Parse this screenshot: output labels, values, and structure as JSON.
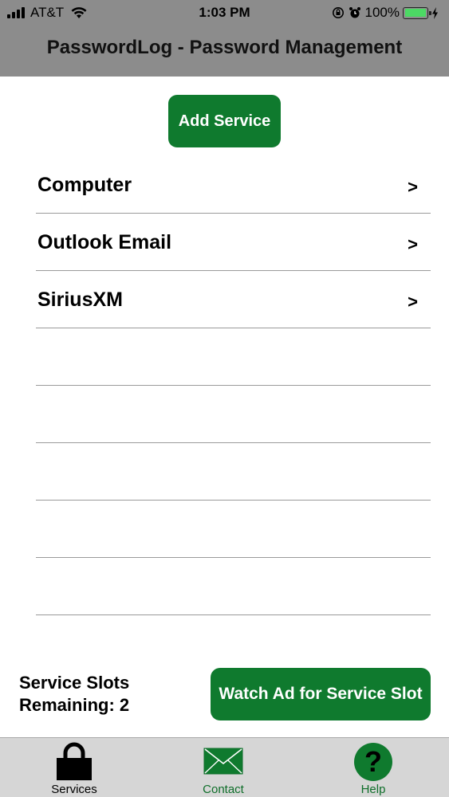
{
  "status_bar": {
    "carrier": "AT&T",
    "time": "1:03 PM",
    "battery_percent": "100%",
    "battery_fraction": 1.0
  },
  "header": {
    "title": "PasswordLog - Password Management"
  },
  "add_service_label": "Add Service",
  "services": [
    {
      "label": "Computer",
      "chevron": ">"
    },
    {
      "label": "Outlook Email",
      "chevron": ">"
    },
    {
      "label": "SiriusXM",
      "chevron": ">"
    },
    {
      "label": "",
      "chevron": ""
    },
    {
      "label": "",
      "chevron": ""
    },
    {
      "label": "",
      "chevron": ""
    },
    {
      "label": "",
      "chevron": ""
    },
    {
      "label": "",
      "chevron": ""
    }
  ],
  "slots": {
    "line1": "Service Slots",
    "line2": "Remaining: 2"
  },
  "watch_ad_label": "Watch Ad for Service Slot",
  "tabbar": {
    "services": {
      "label": "Services",
      "icon": "lock-icon"
    },
    "contact": {
      "label": "Contact",
      "icon": "envelope-icon"
    },
    "help": {
      "label": "Help",
      "icon": "question-icon"
    }
  },
  "colors": {
    "accent": "#0f7a2e",
    "header_bg": "#8c8c8c",
    "tabbar_bg": "#d6d6d6",
    "battery": "#4cd964"
  }
}
